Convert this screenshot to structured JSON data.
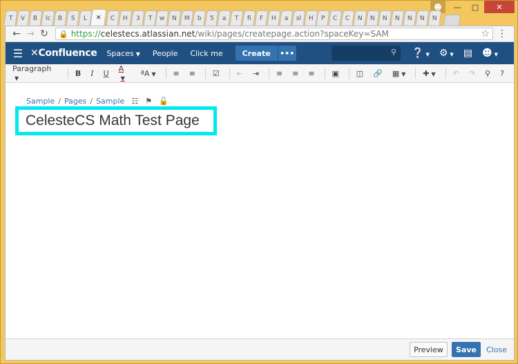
{
  "browser": {
    "tabs": [
      "T",
      "V",
      "B",
      "lc",
      "B",
      "S",
      "L",
      "✕",
      "C",
      "H",
      "3",
      "T",
      "w",
      "N",
      "M",
      "b",
      "5",
      "a",
      "T",
      "fi",
      "F",
      "H",
      "a",
      "sl",
      "H",
      "P",
      "C",
      "C",
      "N",
      "N",
      "N",
      "N",
      "N",
      "N",
      "N"
    ],
    "url": {
      "scheme": "https://",
      "host": "celestecs.atlassian.net",
      "path": "/wiki/pages/createpage.action?spaceKey=SAM"
    }
  },
  "header": {
    "logo": "Confluence",
    "nav": [
      "Spaces",
      "People",
      "Click me"
    ],
    "create_label": "Create",
    "more_label": "•••"
  },
  "toolbar": {
    "paragraph": "Paragraph",
    "bold": "B",
    "italic": "I",
    "underline": "U",
    "text_color": "A",
    "format_more": "ªA"
  },
  "content": {
    "breadcrumb": [
      "Sample",
      "Pages",
      "Sample"
    ],
    "title": "CelesteCS Math Test Page"
  },
  "footer": {
    "preview": "Preview",
    "save": "Save",
    "close": "Close"
  },
  "colors": {
    "brand": "#205081",
    "accent": "#3572b0",
    "highlight": "#00e8f0"
  }
}
